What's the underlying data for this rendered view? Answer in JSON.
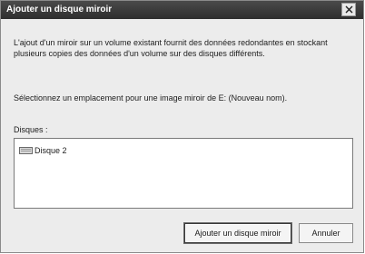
{
  "dialog": {
    "title": "Ajouter un disque miroir",
    "description": "L'ajout d'un miroir sur un volume existant fournit des données redondantes en stockant\nplusieurs copies des données d'un volume sur des disques différents.",
    "prompt": "Sélectionnez un emplacement pour une image miroir de E: (Nouveau nom).",
    "disks_label": "Disques :",
    "disks": [
      {
        "label": "Disque 2",
        "icon": "disk-icon"
      }
    ],
    "buttons": {
      "add_mirror": "Ajouter un disque miroir",
      "cancel": "Annuler"
    },
    "close_icon": "close-icon"
  }
}
